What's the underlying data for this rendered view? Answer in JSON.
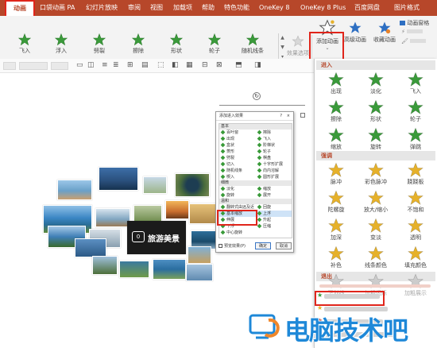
{
  "tabs": [
    {
      "label": "动画",
      "active": true
    },
    {
      "label": "口袋动画 PA"
    },
    {
      "label": "幻灯片放映"
    },
    {
      "label": "审阅"
    },
    {
      "label": "视图"
    },
    {
      "label": "加载项"
    },
    {
      "label": "帮助"
    },
    {
      "label": "特色功能"
    },
    {
      "label": "OneKey 8"
    },
    {
      "label": "OneKey 8 Plus"
    },
    {
      "label": "百度网盘"
    },
    {
      "label": "图片格式"
    }
  ],
  "ribbon": {
    "gallery": [
      {
        "label": "飞入",
        "icon": "star-green-icon"
      },
      {
        "label": "浮入",
        "icon": "star-green-icon"
      },
      {
        "label": "劈裂",
        "icon": "star-green-icon"
      },
      {
        "label": "擦除",
        "icon": "star-green-icon"
      },
      {
        "label": "形状",
        "icon": "star-green-icon"
      },
      {
        "label": "轮子",
        "icon": "star-green-icon"
      },
      {
        "label": "随机线条",
        "icon": "star-green-icon"
      }
    ],
    "effect_options": "效果选项",
    "add_animation": "添加动画",
    "advanced_animation": "高级动画",
    "favorite_animation": "收藏动画",
    "animation_pane": "动画窗格",
    "group_label": "动画"
  },
  "dialog": {
    "title": "添加进入效果",
    "help": "?",
    "close": "×",
    "categories": [
      {
        "name": "基本",
        "rows": [
          [
            "百叶窗",
            "擦除"
          ],
          [
            "出现",
            "飞入"
          ],
          [
            "盒状",
            "阶梯状"
          ],
          [
            "菱形",
            "轮子"
          ],
          [
            "劈裂",
            "棋盘"
          ],
          [
            "切入",
            "十字形扩展"
          ],
          [
            "随机线条",
            "向内溶解"
          ],
          [
            "楔入",
            "圆形扩展"
          ]
        ]
      },
      {
        "name": "细微",
        "rows": [
          [
            "淡化",
            "缩放"
          ],
          [
            "旋转",
            "展开"
          ]
        ]
      },
      {
        "name": "温和",
        "rows": [
          [
            "翻转式由远及近",
            "回旋"
          ],
          [
            "基本缩放",
            "上浮"
          ],
          [
            "伸展",
            "升起"
          ],
          [
            "下浮",
            "压缩"
          ],
          [
            "中心旋转",
            ""
          ]
        ]
      }
    ],
    "preview_label": "预览效果(P)",
    "ok": "确定",
    "cancel": "取消"
  },
  "canvas": {
    "center_text": "旅游美景"
  },
  "panel": {
    "entrance_header": "进入",
    "entrance": [
      {
        "label": "出现",
        "color": "#3a9a3a"
      },
      {
        "label": "淡化",
        "color": "#3a9a3a"
      },
      {
        "label": "飞入",
        "color": "#3a9a3a"
      },
      {
        "label": "擦除",
        "color": "#3a9a3a"
      },
      {
        "label": "形状",
        "color": "#3a9a3a"
      },
      {
        "label": "轮子",
        "color": "#3a9a3a"
      },
      {
        "label": "缩放",
        "color": "#3a9a3a"
      },
      {
        "label": "旋转",
        "color": "#3a9a3a"
      },
      {
        "label": "弹跳",
        "color": "#3a9a3a"
      }
    ],
    "emphasis_header": "强调",
    "emphasis": [
      {
        "label": "脉冲",
        "color": "#e6b12a"
      },
      {
        "label": "彩色脉冲",
        "color": "#e6b12a"
      },
      {
        "label": "跷跷板",
        "color": "#e6b12a"
      },
      {
        "label": "陀螺旋",
        "color": "#e6b12a"
      },
      {
        "label": "放大/缩小",
        "color": "#e6b12a"
      },
      {
        "label": "不饱和",
        "color": "#e6b12a"
      },
      {
        "label": "加深",
        "color": "#e6b12a"
      },
      {
        "label": "变淡",
        "color": "#e6b12a"
      },
      {
        "label": "透明",
        "color": "#e6b12a"
      },
      {
        "label": "补色",
        "color": "#e6b12a"
      },
      {
        "label": "线条颜色",
        "color": "#e6b12a"
      },
      {
        "label": "填充颜色",
        "color": "#e6b12a"
      },
      {
        "label": "下划线",
        "color": "#cccccc",
        "dim": true
      },
      {
        "label": "加粗闪烁",
        "color": "#cccccc",
        "dim": true
      },
      {
        "label": "加粗展示",
        "color": "#cccccc",
        "dim": true
      }
    ],
    "exit_header": "退出"
  },
  "watermark": {
    "text": "电脑技术吧"
  },
  "colors": {
    "accent": "#b7472a",
    "highlight": "#e0251b",
    "entrance": "#3a9a3a",
    "emphasis": "#e6b12a",
    "watermark": "#1e88d8"
  }
}
